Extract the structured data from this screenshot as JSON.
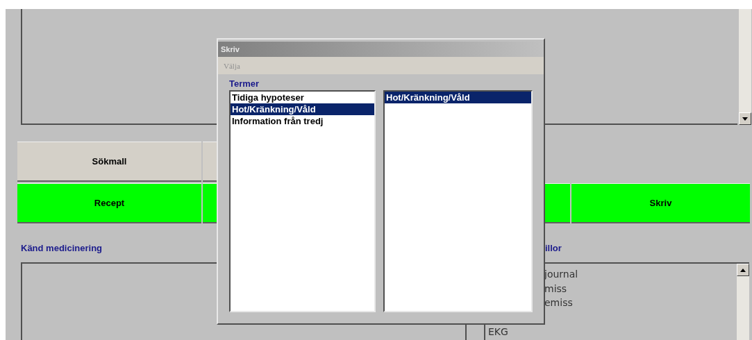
{
  "top_row_buttons": [
    {
      "label": "Sökmall"
    }
  ],
  "action_buttons": [
    {
      "label": "Recept"
    },
    {
      "label": "Skriv"
    }
  ],
  "left_section": {
    "title": "Känd medicinering"
  },
  "right_section": {
    "title": "illor",
    "items": [
      {
        "text": "journal",
        "kind": "cut"
      },
      {
        "text": "miss",
        "kind": "cut"
      },
      {
        "text": "emiss",
        "kind": "cut"
      },
      {
        "text": "EKG",
        "kind": "whole"
      }
    ]
  },
  "dialog": {
    "title": "Skriv",
    "menu": [
      {
        "label": "Välja",
        "disabled": true
      }
    ],
    "group_label": "Termer",
    "terms": [
      {
        "text": "Tidiga hypoteser",
        "selected": false
      },
      {
        "text": "Hot/Kränkning/Våld",
        "selected": true
      },
      {
        "text": "Information från tredj",
        "selected": false
      }
    ],
    "chosen": [
      {
        "text": "Hot/Kränkning/Våld",
        "selected": true
      }
    ]
  }
}
